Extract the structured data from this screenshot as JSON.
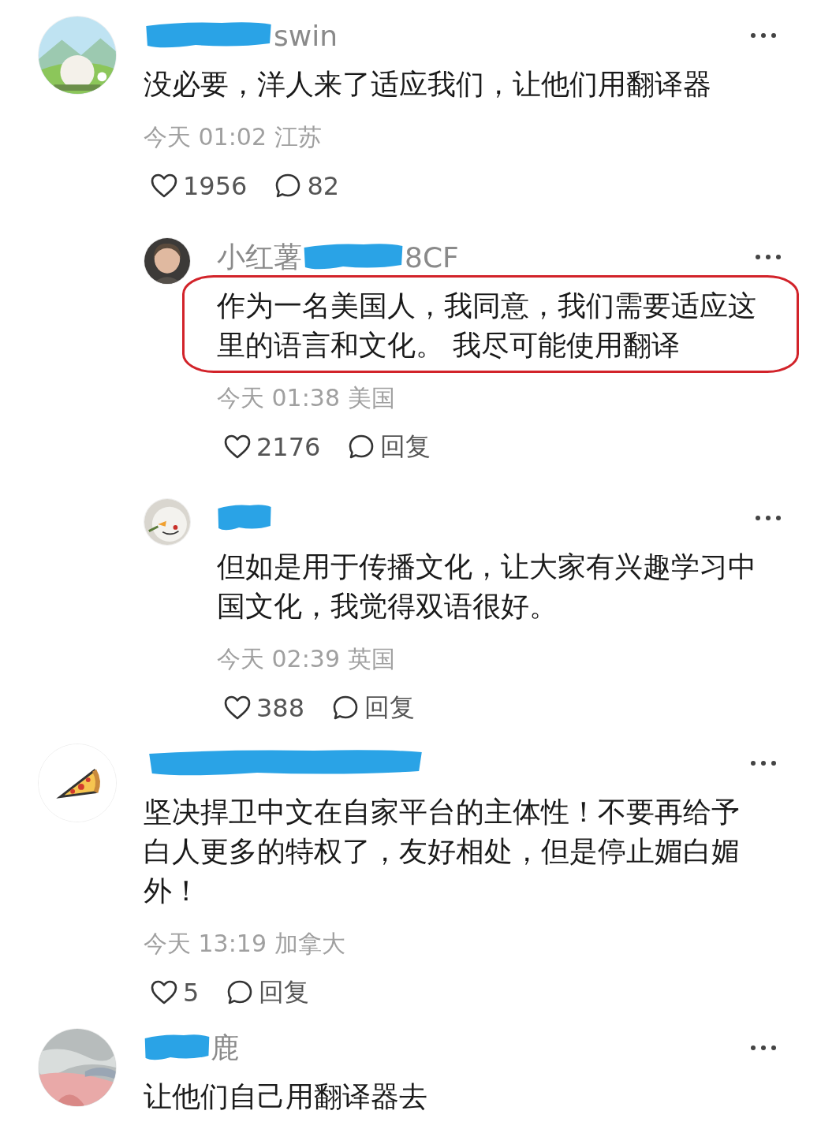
{
  "comments": [
    {
      "name_parts": [
        {
          "kind": "scribble"
        },
        {
          "kind": "text",
          "text": "swin"
        }
      ],
      "text": "没必要，洋人来了适应我们，让他们用翻译器",
      "meta": "今天 01:02 江苏",
      "likes": "1956",
      "replies": "82",
      "highlighted": false,
      "children": [
        {
          "name_parts": [
            {
              "kind": "text",
              "text": "小红薯"
            },
            {
              "kind": "scribble"
            },
            {
              "kind": "text",
              "text": "8CF"
            }
          ],
          "text": "作为一名美国人，我同意，我们需要适应这里的语言和文化。 我尽可能使用翻译",
          "meta": "今天 01:38 美国",
          "likes": "2176",
          "replies": "回复",
          "highlighted": true
        },
        {
          "name_parts": [
            {
              "kind": "scribble"
            }
          ],
          "text": "但如是用于传播文化，让大家有兴趣学习中国文化，我觉得双语很好。",
          "meta": "今天 02:39 英国",
          "likes": "388",
          "replies": "回复",
          "highlighted": false
        }
      ]
    },
    {
      "name_parts": [
        {
          "kind": "scribble"
        }
      ],
      "text": "坚决捍卫中文在自家平台的主体性！不要再给予白人更多的特权了，友好相处，但是停止媚白媚外！",
      "meta": "今天 13:19 加拿大",
      "likes": "5",
      "replies": "回复",
      "highlighted": false
    },
    {
      "name_parts": [
        {
          "kind": "scribble"
        },
        {
          "kind": "text",
          "text": "鹿"
        }
      ],
      "text": "让他们自己用翻译器去",
      "highlighted": false
    }
  ]
}
